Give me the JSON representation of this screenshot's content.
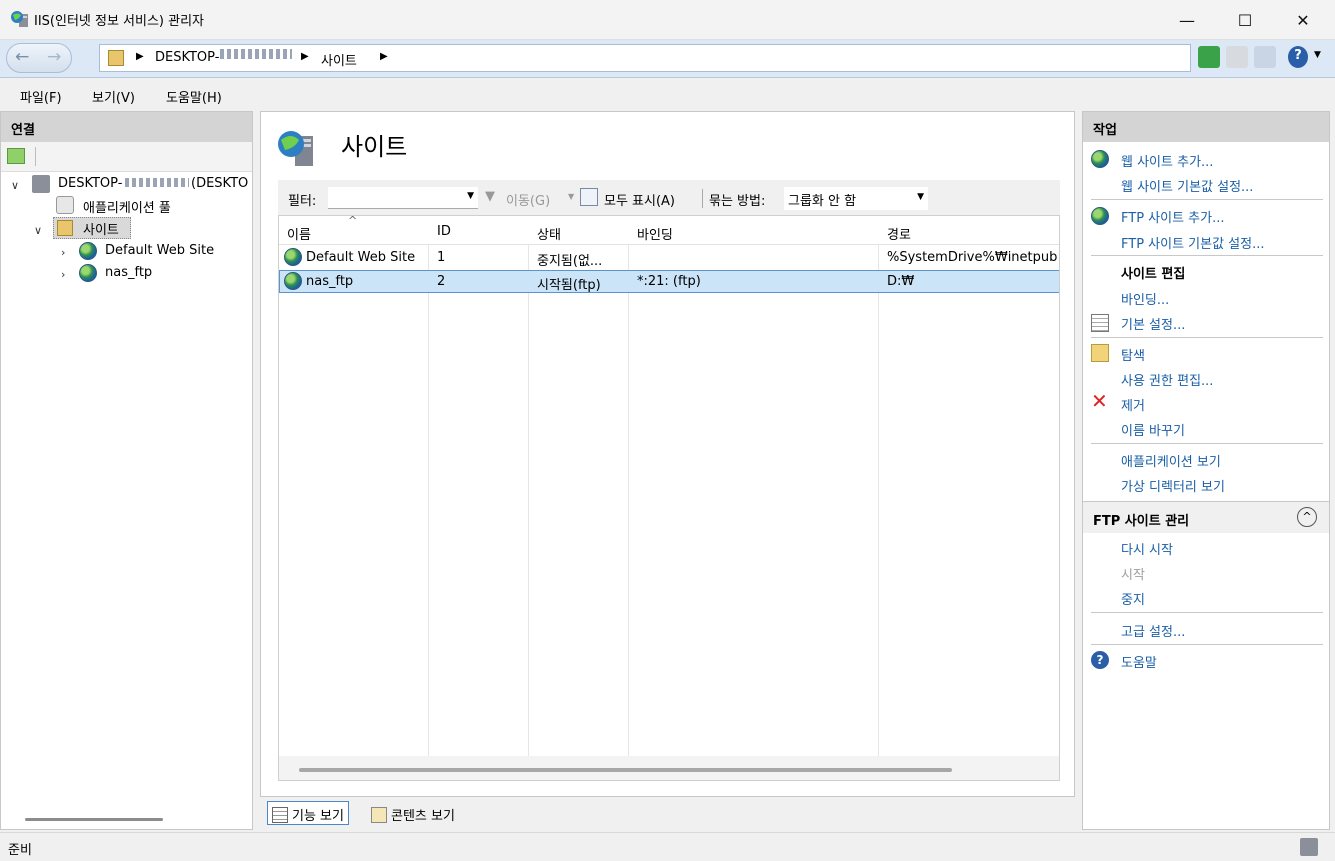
{
  "window": {
    "title": "IIS(인터넷 정보 서비스) 관리자",
    "minimize": "—",
    "maximize": "☐",
    "close": "✕"
  },
  "address": {
    "crumbs": [
      "DESKTOP-",
      "사이트"
    ]
  },
  "menu": [
    "파일(F)",
    "보기(V)",
    "도움말(H)"
  ],
  "connections": {
    "header": "연결",
    "tree": {
      "root": "DESKTOP-",
      "root_suffix": "(DESKTO",
      "app_pool": "애플리케이션 풀",
      "sites": "사이트",
      "site_items": [
        "Default Web Site",
        "nas_ftp"
      ]
    }
  },
  "center": {
    "title": "사이트",
    "filter": {
      "label": "필터:",
      "go": "이동(G)",
      "show_all": "모두 표시(A)",
      "group_label": "묶는 방법:",
      "group_value": "그룹화 안 함"
    },
    "columns": [
      "이름",
      "ID",
      "상태",
      "바인딩",
      "경로"
    ],
    "rows": [
      {
        "name": "Default Web Site",
        "id": "1",
        "status": "중지됨(없...",
        "binding": "",
        "path": "%SystemDrive%₩inetpub"
      },
      {
        "name": "nas_ftp",
        "id": "2",
        "status": "시작됨(ftp)",
        "binding": "*:21: (ftp)",
        "path": "D:₩"
      }
    ],
    "tabs": {
      "features": "기능 보기",
      "content": "콘텐츠 보기"
    }
  },
  "actions": {
    "header": "작업",
    "add_web_site": "웹 사이트 추가...",
    "web_site_defaults": "웹 사이트 기본값 설정...",
    "add_ftp_site": "FTP 사이트 추가...",
    "ftp_site_defaults": "FTP 사이트 기본값 설정...",
    "edit_site_header": "사이트 편집",
    "bindings": "바인딩...",
    "basic_settings": "기본 설정...",
    "explore": "탐색",
    "edit_permissions": "사용 권한 편집...",
    "remove": "제거",
    "rename": "이름 바꾸기",
    "view_applications": "애플리케이션 보기",
    "view_virtual_dirs": "가상 디렉터리 보기",
    "manage_ftp_header": "FTP 사이트 관리",
    "restart": "다시 시작",
    "start": "시작",
    "stop": "중지",
    "advanced_settings": "고급 설정...",
    "help": "도움말"
  },
  "status": {
    "text": "준비"
  },
  "colors": {
    "link": "#1a5fa8",
    "selected_row": "#cce4f7",
    "panel_header": "#d4d4d4"
  }
}
